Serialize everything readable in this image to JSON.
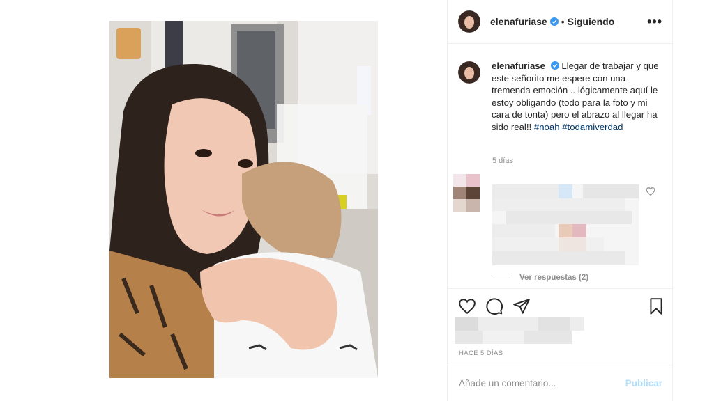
{
  "post": {
    "username": "elenafuriase",
    "separator": "•",
    "follow_status": "Siguiendo",
    "more_icon": "more-options-icon",
    "caption_text": "Llegar de trabajar y que este señorito me espere con una tremenda emoción .. lógicamente aquí le estoy obligando (todo para la foto y mi cara de tonta) pero el abrazo al llegar ha sido real!!",
    "hashtags": [
      "#noah",
      "#todamiverdad"
    ],
    "caption_time": "5 días",
    "view_replies": "Ver respuestas (2)",
    "timestamp": "HACE 5 DÍAS",
    "comment_placeholder": "Añade un comentario...",
    "publish_label": "Publicar"
  },
  "colors": {
    "verified_blue": "#3897f0",
    "hashtag_blue": "#00376b",
    "publish_disabled": "#b2dffc",
    "muted_text": "#8e8e8e",
    "border": "#efefef"
  },
  "icons": {
    "like": "heart-icon",
    "comment": "comment-bubble-icon",
    "share": "paper-plane-icon",
    "save": "bookmark-icon",
    "comment_like": "small-heart-icon",
    "verified": "verified-badge-icon"
  }
}
